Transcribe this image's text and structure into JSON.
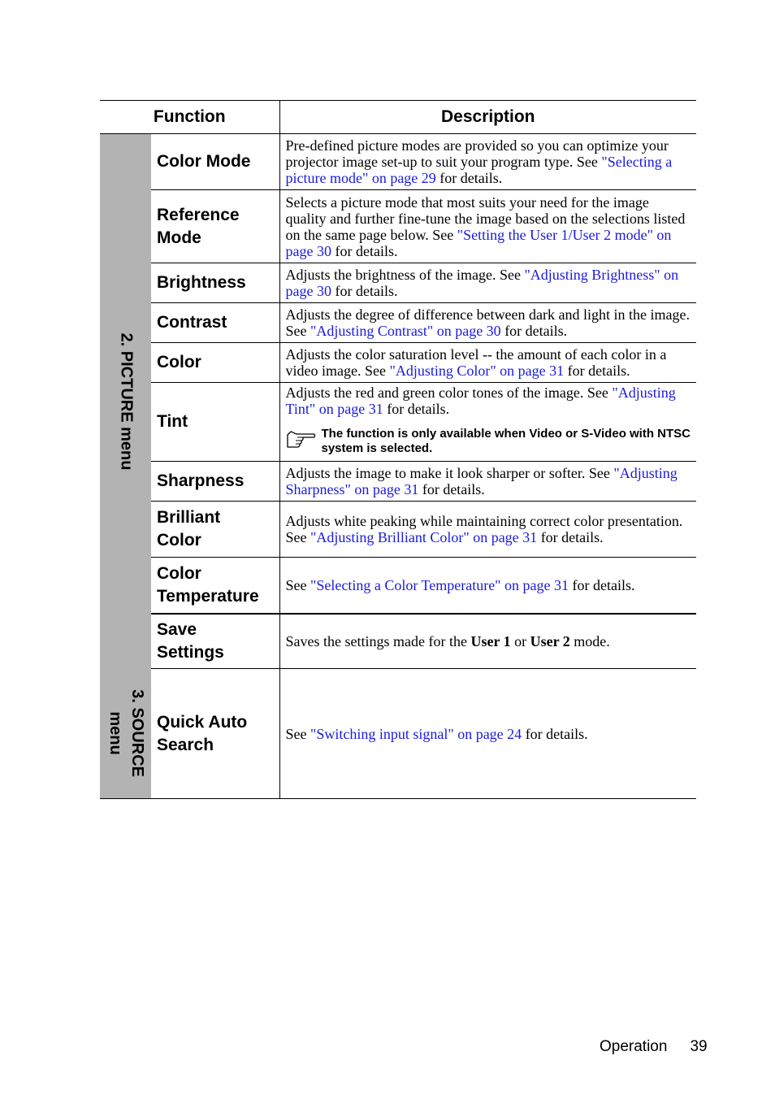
{
  "table": {
    "headers": {
      "function": "Function",
      "description": "Description"
    },
    "groups": [
      {
        "label": "2. PICTURE menu"
      },
      {
        "label_line1": "3. SOURCE",
        "label_line2": "menu"
      }
    ],
    "rows": [
      {
        "function": "Color Mode",
        "text_before": "Pre-defined picture modes are provided so you can optimize your projector image set-up to suit your program type. See ",
        "link": "\"Selecting a picture mode\" on page 29",
        "text_after": " for details."
      },
      {
        "function_line1": "Reference",
        "function_line2": "Mode",
        "text_before": "Selects a picture mode that most suits your need for the image quality and further fine-tune the image based on the selections listed on the same page below. See ",
        "link": "\"Setting the User 1/User 2 mode\" on page 30",
        "text_after": " for details."
      },
      {
        "function": "Brightness",
        "text_before": "Adjusts the brightness of the image. See ",
        "link": "\"Adjusting Brightness\" on page 30",
        "text_after": " for details."
      },
      {
        "function": "Contrast",
        "text_before": "Adjusts the degree of difference between dark and light in the image. See ",
        "link": "\"Adjusting Contrast\" on page 30",
        "text_after": " for details."
      },
      {
        "function": "Color",
        "text_before": "Adjusts the color saturation level -- the amount of each color in a video image. See ",
        "link": "\"Adjusting Color\" on page 31",
        "text_after": " for details."
      },
      {
        "function": "Tint",
        "text_before": "Adjusts the red and green color tones of the image. See ",
        "link": "\"Adjusting Tint\" on page 31",
        "text_after": " for details.",
        "note": "The function is only available when Video or S-Video with NTSC system is selected.",
        "note_icon": "pointing-hand-icon"
      },
      {
        "function": "Sharpness",
        "text_before": "Adjusts the image to make it look sharper or softer. See ",
        "link": "\"Adjusting Sharpness\" on page 31",
        "text_after": " for details."
      },
      {
        "function_line1": "Brilliant",
        "function_line2": "Color",
        "text_before": "Adjusts white peaking while maintaining correct color presentation. See ",
        "link": "\"Adjusting Brilliant Color\" on page 31",
        "text_after": " for details."
      },
      {
        "function_line1": "Color",
        "function_line2": "Temperature",
        "text_before": "See ",
        "link": "\"Selecting a Color Temperature\" on page 31",
        "text_after": " for details."
      },
      {
        "function_line1": "Save",
        "function_line2": "Settings",
        "text_before": "Saves the settings made for the ",
        "bold1": "User 1",
        "text_mid": " or ",
        "bold2": "User 2",
        "text_after": " mode."
      },
      {
        "function_line1": "Quick Auto",
        "function_line2": "Search",
        "text_before": "See ",
        "link": "\"Switching input signal\" on page 24",
        "text_after": " for details."
      }
    ]
  },
  "footer": {
    "section": "Operation",
    "page_number": "39"
  },
  "colors": {
    "link": "#1a1adf",
    "group_band": "#b3b3b3"
  }
}
